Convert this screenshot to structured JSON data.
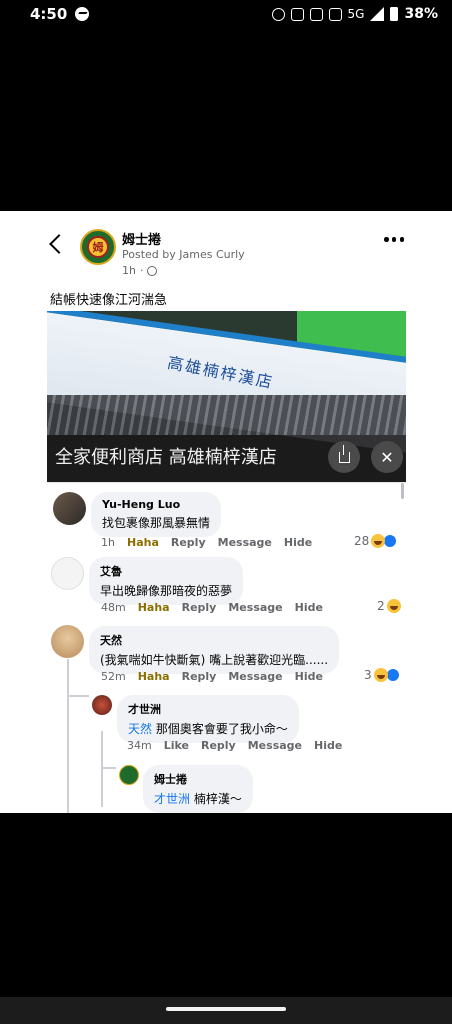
{
  "status_bar": {
    "time": "4:50",
    "network": "5G",
    "battery": "38%"
  },
  "post": {
    "page_name": "姆士捲",
    "posted_by": "Posted by James Curly",
    "time": "1h",
    "avatar_char": "姆",
    "text": "結帳快速像江河湍急",
    "media": {
      "sign_text": "高雄楠梓漢店",
      "caption": "全家便利商店 高雄楠梓漢店"
    }
  },
  "comments": [
    {
      "name": "Yu-Heng Luo",
      "text": "找包裹像那風暴無情",
      "time": "1h",
      "reaction_label": "Haha",
      "reply": "Reply",
      "message": "Message",
      "hide": "Hide",
      "count": "28"
    },
    {
      "name": "艾魯",
      "text": "早出晚歸像那暗夜的惡夢",
      "time": "48m",
      "reaction_label": "Haha",
      "reply": "Reply",
      "message": "Message",
      "hide": "Hide",
      "count": "2"
    },
    {
      "name": "天然",
      "text": "(我氣喘如牛快斷氣) 嘴上說著歡迎光臨......",
      "time": "52m",
      "reaction_label": "Haha",
      "reply": "Reply",
      "message": "Message",
      "hide": "Hide",
      "count": "3"
    },
    {
      "name": "才世洲",
      "mention": "天然",
      "text": "那個奧客會要了我小命～",
      "time": "34m",
      "reaction_label": "Like",
      "reply": "Reply",
      "message": "Message",
      "hide": "Hide"
    },
    {
      "name": "姆士捲",
      "mention": "才世洲",
      "text": "楠梓漢～"
    }
  ],
  "icons": [
    "back-icon",
    "more-icon",
    "globe-icon",
    "share-icon",
    "close-icon",
    "haha-icon",
    "like-icon"
  ],
  "colors": {
    "link_blue": "#1877f2",
    "bubble_gray": "#f0f2f5",
    "haha_gold": "#8b6d00"
  }
}
